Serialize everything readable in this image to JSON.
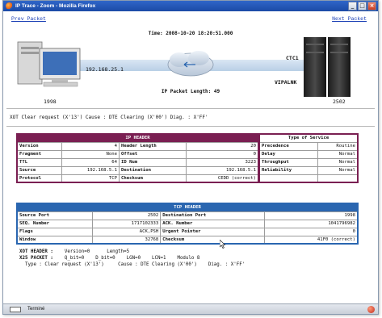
{
  "window": {
    "title": "IP Trace - Zoom - Mozilla Firefox",
    "buttons": [
      "_",
      "□",
      "×"
    ]
  },
  "nav": {
    "prev_label": "Prev Packet",
    "next_label": "Next Packet"
  },
  "packet": {
    "time_label": "Time: 2008-10-20 18:20:51.000",
    "src_ip": "192.168.25.1",
    "src_name": "1998",
    "dst_name": "2502",
    "ctc_label": "CTC1",
    "host_label": "VIPALNK",
    "length_label": "IP Packet Length: 49"
  },
  "trace_line": "XOT Clear request (X'13') Cause : DTE Clearing (X'00') Diag. : X'FF'",
  "ip_header": {
    "title": "IP HEADER",
    "tos_title": "Type of Service",
    "rows": [
      {
        "k1": "Version",
        "v1": "4",
        "k2": "Header Length",
        "v2": "20",
        "k3": "Precedence",
        "v3": "Routine"
      },
      {
        "k1": "Fragment",
        "v1": "None",
        "k2": "Offset",
        "v2": "0",
        "k3": "Delay",
        "v3": "Normal"
      },
      {
        "k1": "TTL",
        "v1": "64",
        "k2": "ID Num",
        "v2": "3223",
        "k3": "Throughput",
        "v3": "Normal"
      },
      {
        "k1": "Source",
        "v1": "192.168.5.1",
        "k2": "Destination",
        "v2": "192.168.5.1",
        "k3": "Reliability",
        "v3": "Normal"
      },
      {
        "k1": "Protocol",
        "v1": "TCP",
        "k2": "Checksum",
        "v2": "CEDD (correct)",
        "k3": "",
        "v3": ""
      }
    ]
  },
  "tcp_header": {
    "title": "TCP HEADER",
    "rows": [
      {
        "k1": "Source Port",
        "v1": "2502",
        "k2": "Destination Port",
        "v2": "1998"
      },
      {
        "k1": "SEQ. Number",
        "v1": "1717102333",
        "k2": "ACK. Number",
        "v2": "1041796982"
      },
      {
        "k1": "Flags",
        "v1": "ACK,PSH",
        "k2": "Urgent Pointer",
        "v2": "0"
      },
      {
        "k1": "Window",
        "v1": "32768",
        "k2": "Checksum",
        "v2": "41F0 (correct)"
      }
    ]
  },
  "decode": {
    "l1_k": "XOT HEADER :",
    "l1_v": "    Version=0      Length=5",
    "l2_k": "X25 PACKET :",
    "l2_v": "    Q_bit=0    D_bit=0    LGN=0    LCN=1    Modulo 8",
    "l3": "  Type : Clear request (X'13')     Cause : DTE Clearing (X'00')    Diag. : X'FF'"
  },
  "status": {
    "text": "Terminé"
  },
  "colors": {
    "ip_accent": "#7a1f52",
    "tcp_accent": "#2a66b0"
  }
}
